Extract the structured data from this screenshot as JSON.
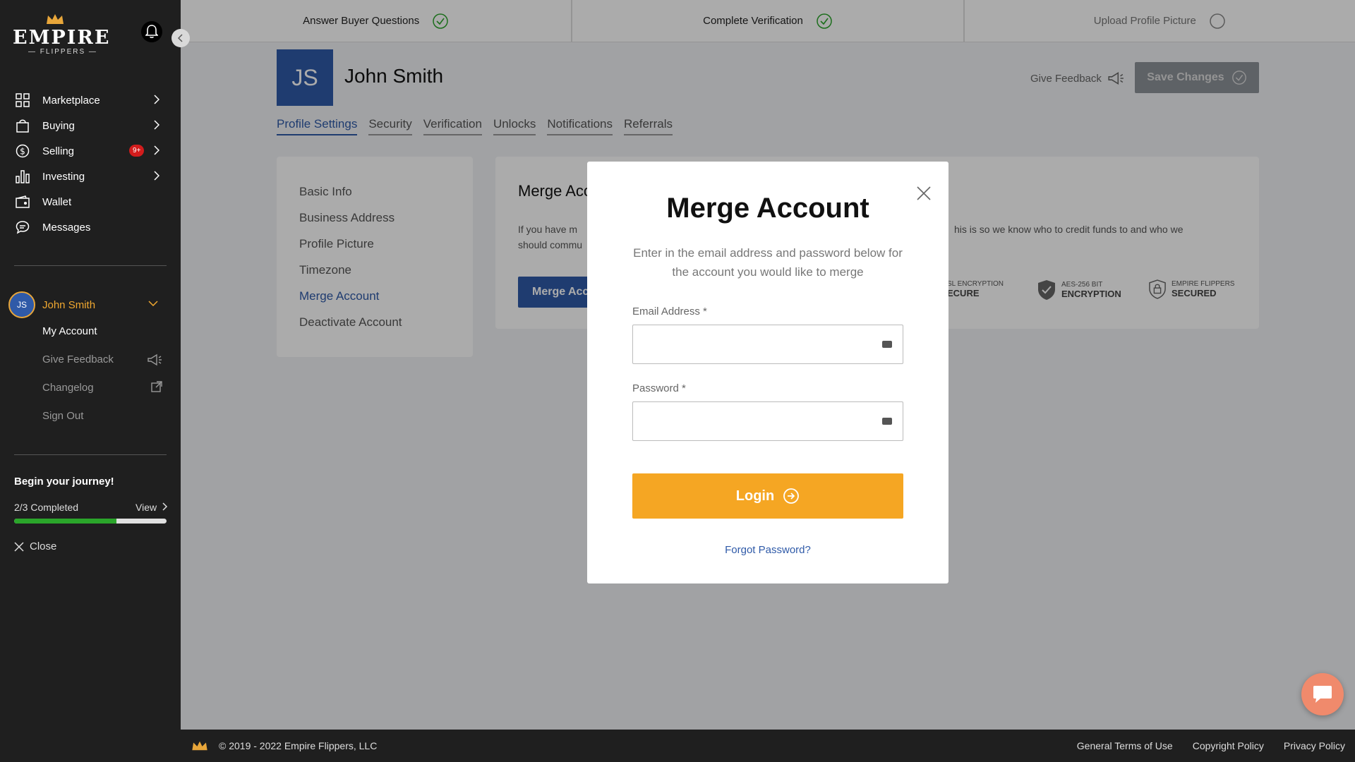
{
  "brand": {
    "name": "EMPIRE",
    "sub": "— FLIPPERS —"
  },
  "sidebar": {
    "nav": [
      {
        "label": "Marketplace",
        "icon": "grid-icon",
        "chevron": true
      },
      {
        "label": "Buying",
        "icon": "bag-icon",
        "chevron": true
      },
      {
        "label": "Selling",
        "icon": "dollar-icon",
        "chevron": true,
        "badge": "9+"
      },
      {
        "label": "Investing",
        "icon": "bar-chart-icon",
        "chevron": true
      },
      {
        "label": "Wallet",
        "icon": "wallet-icon",
        "chevron": false
      },
      {
        "label": "Messages",
        "icon": "chat-icon",
        "chevron": false
      }
    ],
    "user": {
      "initials": "JS",
      "name": "John Smith"
    },
    "user_menu": [
      "My Account",
      "Give Feedback",
      "Changelog",
      "Sign Out"
    ],
    "journey": {
      "title": "Begin your journey!",
      "progress_text": "2/3 Completed",
      "view_label": "View",
      "progress": 0.67
    },
    "close_label": "Close"
  },
  "steps": [
    {
      "label": "Answer Buyer Questions",
      "done": true
    },
    {
      "label": "Complete Verification",
      "done": true
    },
    {
      "label": "Upload Profile Picture",
      "done": false
    }
  ],
  "profile": {
    "initials": "JS",
    "name": "John Smith",
    "give_feedback": "Give Feedback",
    "save_label": "Save Changes"
  },
  "tabs": [
    "Profile Settings",
    "Security",
    "Verification",
    "Unlocks",
    "Notifications",
    "Referrals"
  ],
  "settings_menu": [
    "Basic Info",
    "Business Address",
    "Profile Picture",
    "Timezone",
    "Merge Account",
    "Deactivate Account"
  ],
  "main_card": {
    "title": "Merge Acc",
    "desc_left": "If you have m",
    "desc_left2": "should commu",
    "desc_right": "his is so we know who to credit funds to and who we",
    "button": "Merge Acc",
    "badges": [
      {
        "top": "SL ENCRYPTION",
        "bottom": "ECURE"
      },
      {
        "top": "AES-256 BIT",
        "bottom": "ENCRYPTION"
      },
      {
        "top": "EMPIRE FLIPPERS",
        "bottom": "SECURED"
      }
    ]
  },
  "modal": {
    "title": "Merge Account",
    "subtitle": "Enter in the email address and password below for the account you would like to merge",
    "email_label": "Email Address *",
    "email_value": "",
    "password_label": "Password *",
    "password_value": "",
    "login_label": "Login",
    "forgot_label": "Forgot Password?"
  },
  "footer": {
    "copyright": "© 2019 - 2022 Empire Flippers, LLC",
    "links": [
      "General Terms of Use",
      "Copyright Policy",
      "Privacy Policy"
    ]
  },
  "colors": {
    "accent": "#2f5aa8",
    "orange": "#f5a623",
    "green": "#2aa52a",
    "badge": "#d21c1c"
  }
}
